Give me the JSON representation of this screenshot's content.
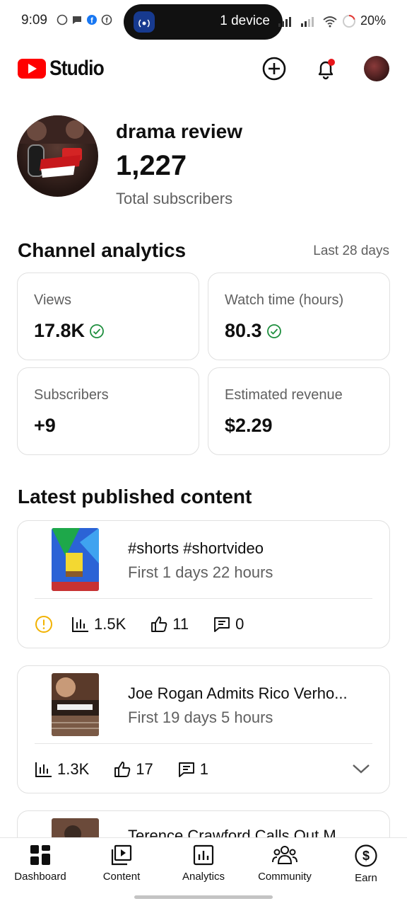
{
  "status_bar": {
    "time": "9:09",
    "pill_text": "1 device",
    "battery": "20%"
  },
  "header": {
    "app_name": "Studio"
  },
  "channel": {
    "name": "drama review",
    "subscriber_count": "1,227",
    "subscriber_label": "Total subscribers"
  },
  "analytics": {
    "title": "Channel analytics",
    "period": "Last 28 days",
    "stats": [
      {
        "label": "Views",
        "value": "17.8K",
        "verified": true
      },
      {
        "label": "Watch time (hours)",
        "value": "80.3",
        "verified": true
      },
      {
        "label": "Subscribers",
        "value": "+9",
        "verified": false
      },
      {
        "label": "Estimated revenue",
        "value": "$2.29",
        "verified": false
      }
    ]
  },
  "latest": {
    "title": "Latest published content",
    "items": [
      {
        "title": "#shorts #shortvideo",
        "subtitle": "First 1 days 22 hours",
        "views": "1.5K",
        "likes": "11",
        "comments": "0",
        "warning": true
      },
      {
        "title": "Joe Rogan Admits Rico Verho...",
        "subtitle": "First 19 days 5 hours",
        "views": "1.3K",
        "likes": "17",
        "comments": "1",
        "warning": false
      },
      {
        "title": "Terence Crawford Calls Out M..."
      }
    ]
  },
  "bottom_nav": {
    "items": [
      {
        "label": "Dashboard",
        "icon": "dashboard-icon"
      },
      {
        "label": "Content",
        "icon": "content-icon"
      },
      {
        "label": "Analytics",
        "icon": "analytics-icon"
      },
      {
        "label": "Community",
        "icon": "community-icon"
      },
      {
        "label": "Earn",
        "icon": "earn-icon"
      }
    ]
  },
  "colors": {
    "brand_red": "#ff0000",
    "check_green": "#1e8e3e",
    "warning_yellow": "#f2b200",
    "secondary_text": "#606060"
  }
}
